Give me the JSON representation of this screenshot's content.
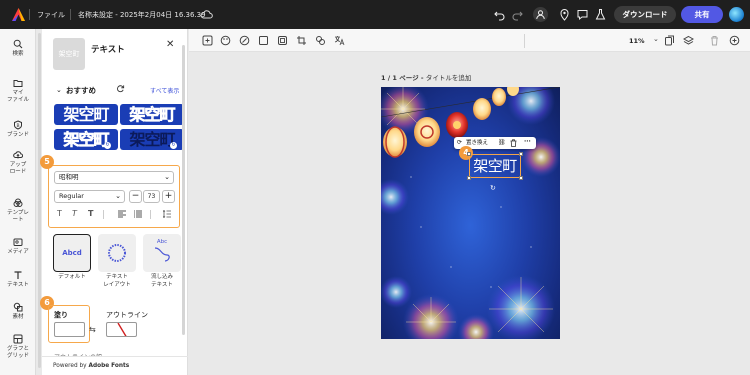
{
  "topbar": {
    "file_label": "ファイル",
    "doc_title": "名称未設定 - 2025年2月04日 16.36.39",
    "download_label": "ダウンロード",
    "share_label": "共有"
  },
  "rail": {
    "items": [
      {
        "label": "検索",
        "icon": "search-icon"
      },
      {
        "label": "マイ\nファイル",
        "icon": "folder-icon"
      },
      {
        "label": "ブランド",
        "icon": "brand-icon"
      },
      {
        "label": "アップ\nロード",
        "icon": "upload-icon"
      },
      {
        "label": "テンプレ\nート",
        "icon": "template-icon"
      },
      {
        "label": "メディア",
        "icon": "media-icon"
      },
      {
        "label": "テキスト",
        "icon": "text-icon"
      },
      {
        "label": "素材",
        "icon": "elements-icon"
      },
      {
        "label": "グラフと\nグリッド",
        "icon": "grid-icon"
      }
    ]
  },
  "panel": {
    "thumb_text": "架空町",
    "title": "テキスト",
    "recommended_label": "おすすめ",
    "show_all_label": "すべて表示",
    "presets": [
      "架空町",
      "架空町",
      "架空町",
      "架空町"
    ],
    "callout_5": "5",
    "font_family": "昭和明",
    "font_weight": "Regular",
    "font_size": "73",
    "layouts": [
      {
        "label": "デフォルト",
        "preview": "Abcd"
      },
      {
        "label": "テキスト\nレイアウト",
        "preview": ""
      },
      {
        "label": "流し込み\nテキスト",
        "preview": "Abc"
      }
    ],
    "callout_6": "6",
    "fill_label": "塗り",
    "outline_label": "アウトライン",
    "cut_label": "アウトラインの幅",
    "powered_prefix": "Powered by ",
    "powered_brand": "Adobe Fonts"
  },
  "canvas": {
    "zoom": "11%",
    "page_prefix": "1 / 1 ページ - ",
    "page_title_placeholder": "タイトルを追加",
    "ctx_replace": "置き換え",
    "callout_4": "4",
    "selected_text": "架空町"
  },
  "colors": {
    "accent": "#5258e4",
    "callout": "#f39b3c",
    "preset_blue": "#1a3db5",
    "artboard_blue": "#2f63d8"
  }
}
